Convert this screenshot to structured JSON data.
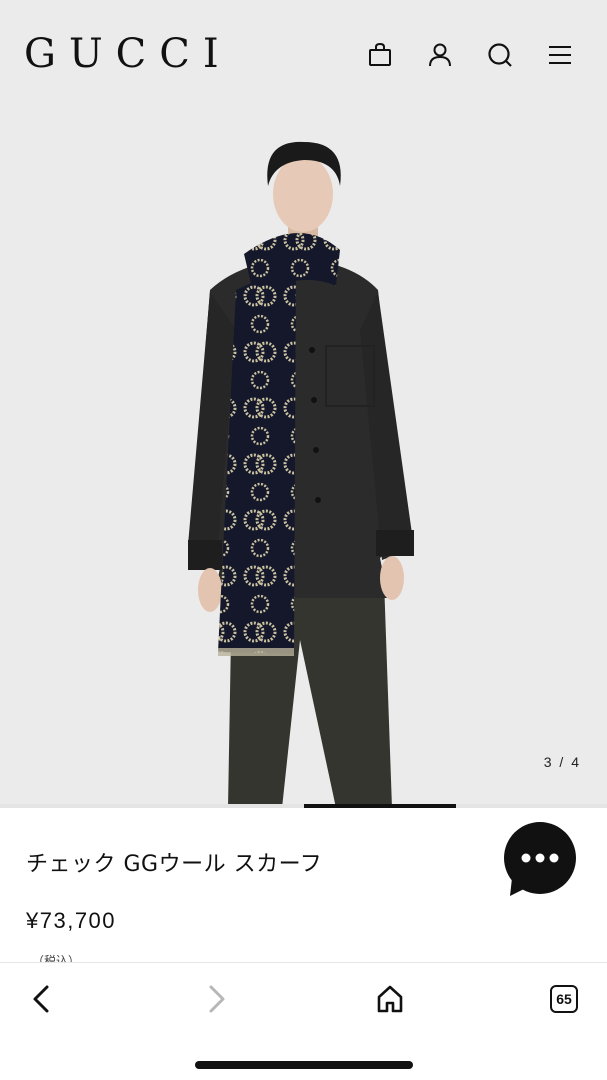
{
  "header": {
    "logo": "GUCCI",
    "icons": [
      "shopping-bag-icon",
      "account-icon",
      "search-icon",
      "menu-icon"
    ]
  },
  "gallery": {
    "counter": "3 / 4",
    "current": 3,
    "total": 4
  },
  "product": {
    "title": "チェック GGウール スカーフ",
    "price": "¥73,700",
    "tax_note": "（税込）"
  },
  "chat": {
    "icon": "chat-bubble-icon"
  },
  "browser_bar": {
    "tab_count": "65",
    "icons": [
      "back-icon",
      "forward-icon",
      "home-icon",
      "tabs-icon"
    ]
  },
  "colors": {
    "hero_bg": "#ebebeb",
    "text": "#111111",
    "chat_bg": "#111111"
  }
}
